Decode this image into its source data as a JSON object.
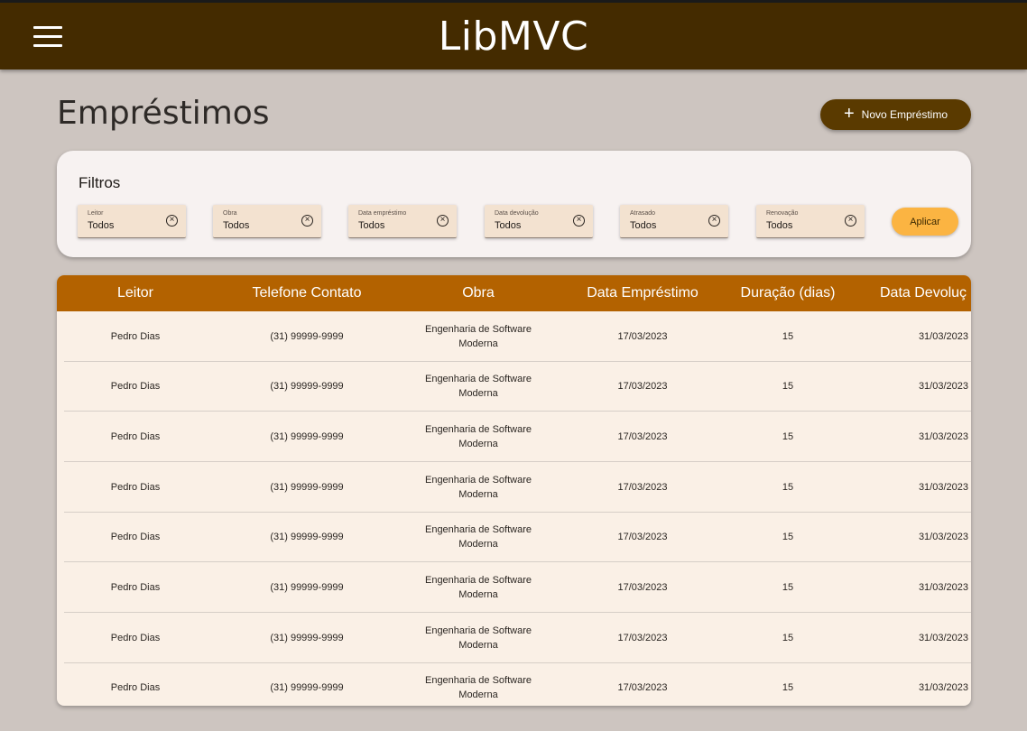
{
  "appbar": {
    "title": "LibMVC",
    "menu_icon": "hamburger-menu-icon"
  },
  "page": {
    "title": "Empréstimos"
  },
  "actions": {
    "new_loan_label": "Novo Empréstimo",
    "new_loan_icon": "plus-icon"
  },
  "filters": {
    "title": "Filtros",
    "items": [
      {
        "label": "Leitor",
        "value": "Todos"
      },
      {
        "label": "Obra",
        "value": "Todos"
      },
      {
        "label": "Data empréstimo",
        "value": "Todos"
      },
      {
        "label": "Data devolução",
        "value": "Todos"
      },
      {
        "label": "Atrasado",
        "value": "Todos"
      },
      {
        "label": "Renovação",
        "value": "Todos"
      }
    ],
    "clear_icon": "circle-x-icon",
    "apply_label": "Aplicar"
  },
  "table": {
    "columns": [
      "Leitor",
      "Telefone Contato",
      "Obra",
      "Data Empréstimo",
      "Duração (dias)",
      "Data Devoluç"
    ],
    "rows": [
      [
        "Pedro Dias",
        "(31) 99999-9999",
        "Engenharia de Software Moderna",
        "17/03/2023",
        "15",
        "31/03/2023"
      ],
      [
        "Pedro Dias",
        "(31) 99999-9999",
        "Engenharia de Software Moderna",
        "17/03/2023",
        "15",
        "31/03/2023"
      ],
      [
        "Pedro Dias",
        "(31) 99999-9999",
        "Engenharia de Software Moderna",
        "17/03/2023",
        "15",
        "31/03/2023"
      ],
      [
        "Pedro Dias",
        "(31) 99999-9999",
        "Engenharia de Software Moderna",
        "17/03/2023",
        "15",
        "31/03/2023"
      ],
      [
        "Pedro Dias",
        "(31) 99999-9999",
        "Engenharia de Software Moderna",
        "17/03/2023",
        "15",
        "31/03/2023"
      ],
      [
        "Pedro Dias",
        "(31) 99999-9999",
        "Engenharia de Software Moderna",
        "17/03/2023",
        "15",
        "31/03/2023"
      ],
      [
        "Pedro Dias",
        "(31) 99999-9999",
        "Engenharia de Software Moderna",
        "17/03/2023",
        "15",
        "31/03/2023"
      ],
      [
        "Pedro Dias",
        "(31) 99999-9999",
        "Engenharia de Software Moderna",
        "17/03/2023",
        "15",
        "31/03/2023"
      ]
    ]
  },
  "colors": {
    "appbar": "#442b00",
    "background": "#cdc5c0",
    "primary_button": "#5a3a00",
    "table_header": "#b36200",
    "apply_button": "#fbb442",
    "filter_chip": "#f3e2d0",
    "table_body": "#faf0e6"
  }
}
